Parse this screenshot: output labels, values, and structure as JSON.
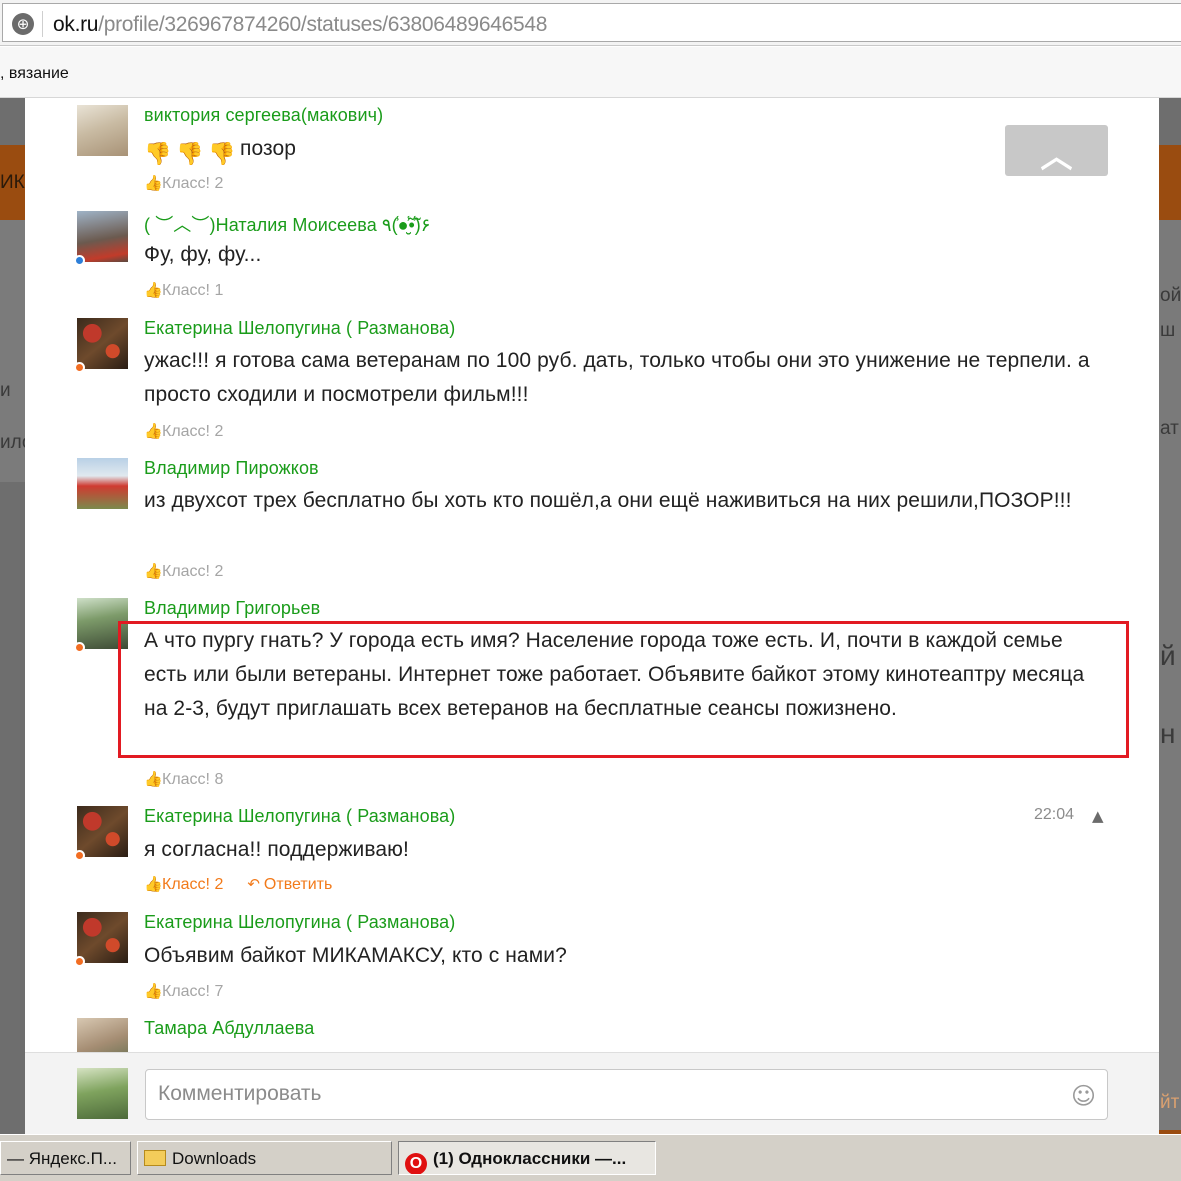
{
  "browser": {
    "url_domain": "ok.ru",
    "url_path": "/profile/326967874260/statuses/63806489646548",
    "bookmark_text": ", вязание"
  },
  "background_fragments": {
    "left_top": "ИК",
    "left_mid": "и",
    "left_low": "ило",
    "right_a": "ой",
    "right_b": "ш",
    "right_c": "ат",
    "right_d": "й",
    "right_e": "н",
    "right_f": "йт"
  },
  "comments": [
    {
      "author": "виктория сергеева(макович)",
      "emoji_count": 3,
      "text": "позор",
      "likes": "Класс! 2"
    },
    {
      "author": "( ︶︿︶)Наталия Моисеева ٩(̾●̮̮̃̾•̃̾)۶",
      "text": "Фу, фу, фу...",
      "likes": "Класс! 1"
    },
    {
      "author": "Екатерина Шелопугина ( Разманова)",
      "text": "ужас!!! я готова сама ветеранам по 100 руб. дать, только чтобы они это унижение не терпели. а просто сходили и посмотрели фильм!!!",
      "likes": "Класс! 2"
    },
    {
      "author": "Владимир Пирожков",
      "text": "из двухсот трех бесплатно бы хоть кто пошёл,а они ещё наживиться на них решили,ПОЗОР!!!",
      "likes": "Класс! 2"
    },
    {
      "author": "Владимир Григорьев",
      "text": "А что пургу гнать? У города есть имя? Население города тоже есть. И, почти в каждой семье есть или были ветераны. Интернет тоже работает. Объявите байкот этому кинотеаптру месяца на 2-3, будут приглашать всех ветеранов на бесплатные сеансы пожизнено.",
      "likes": "Класс! 8"
    },
    {
      "author": "Екатерина Шелопугина ( Разманова)",
      "time": "22:04",
      "text": "я согласна!! поддерживаю!",
      "likes": "Класс! 2",
      "reply": "Ответить"
    },
    {
      "author": "Екатерина Шелопугина ( Разманова)",
      "text": "Объявим байкот МИКАМАКСУ, кто с нами?",
      "likes": "Класс! 7"
    },
    {
      "author": "Тамара Абдуллаева"
    }
  ],
  "composer": {
    "placeholder": "Комментировать"
  },
  "taskbar": {
    "item1": "— Яндекс.П...",
    "item2": "Downloads",
    "item3": "(1) Одноклассники —..."
  },
  "icons": {
    "globe": "globe-icon",
    "scroll_up": "chevron-up-icon",
    "like": "thumb-up-icon",
    "reply": "reply-arrow-icon",
    "warning": "warning-icon",
    "smile": "smile-icon",
    "folder": "folder-icon",
    "opera": "opera-icon"
  },
  "colors": {
    "author": "#1a9c1a",
    "accent": "#f27a1a",
    "highlight": "#e21a22"
  }
}
